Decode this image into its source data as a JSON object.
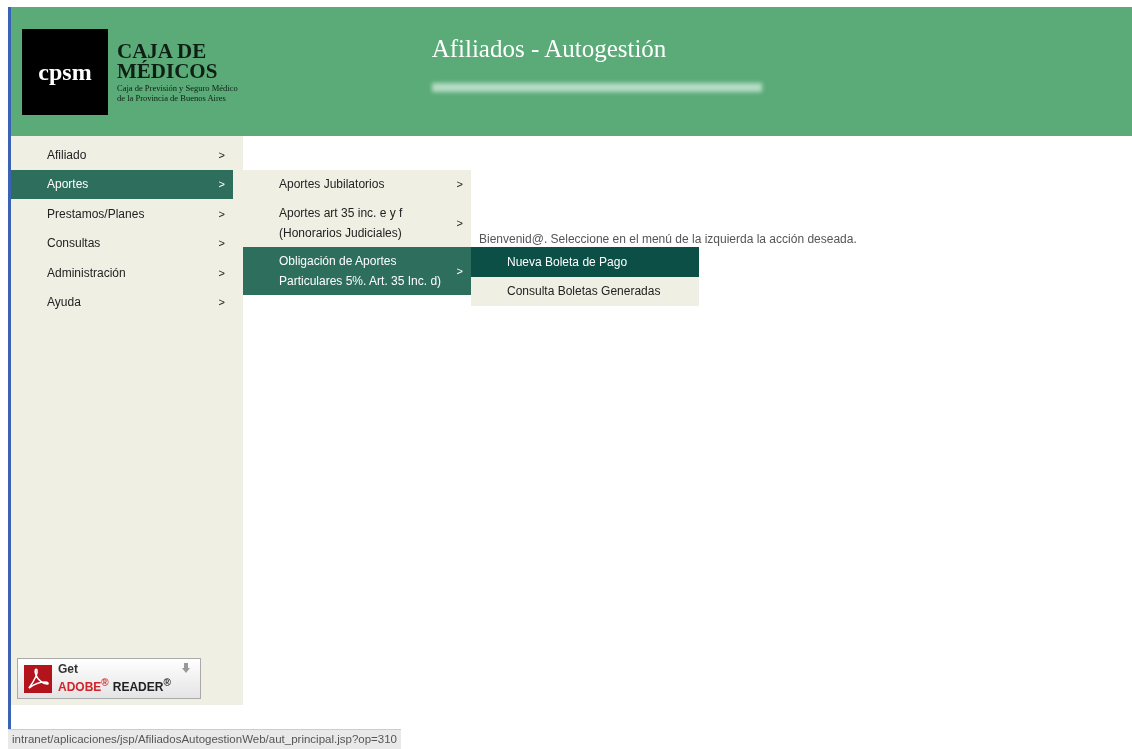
{
  "header": {
    "logo": {
      "mark": "cpsm",
      "name_lines": [
        "CAJA DE",
        "MÉDICOS"
      ],
      "subtitle_lines": [
        "Caja de Previsión y Seguro Médico",
        "de la Provincia de Buenos Aires"
      ]
    },
    "title": "Afiliados - Autogestión"
  },
  "menu": [
    {
      "label": "Afiliado",
      "arrow": ">",
      "selected": false
    },
    {
      "label": "Aportes",
      "arrow": ">",
      "selected": true,
      "children": [
        {
          "label": "Aportes Jubilatorios",
          "arrow": ">",
          "selected": false
        },
        {
          "label": "Aportes art 35 inc. e y f (Honorarios Judiciales)",
          "arrow": ">",
          "selected": false
        },
        {
          "label": "Obligación de Aportes Particulares 5%. Art. 35 Inc. d)",
          "arrow": ">",
          "selected": true,
          "children": [
            {
              "label": "Nueva Boleta de Pago",
              "selected": true
            },
            {
              "label": "Consulta Boletas Generadas",
              "selected": false
            }
          ]
        }
      ]
    },
    {
      "label": "Prestamos/Planes",
      "arrow": ">",
      "selected": false
    },
    {
      "label": "Consultas",
      "arrow": ">",
      "selected": false
    },
    {
      "label": "Administración",
      "arrow": ">",
      "selected": false
    },
    {
      "label": "Ayuda",
      "arrow": ">",
      "selected": false
    }
  ],
  "welcome": "Bienvenid@. Seleccione en el menú de la izquierda la acción deseada.",
  "adobe_button": {
    "get": "Get",
    "brand": "ADOBE$^{®}$",
    "product": "READER$^{®}$"
  },
  "status_bar": "intranet/aplicaciones/jsp/AfiliadosAutogestionWeb/aut_principal.jsp?op=310"
}
